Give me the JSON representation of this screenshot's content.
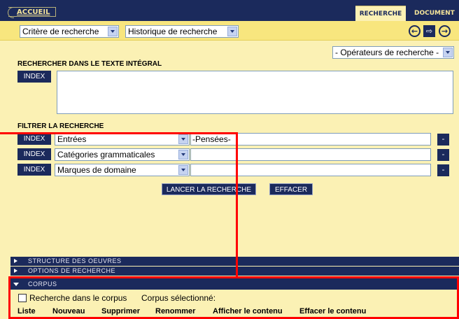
{
  "nav": {
    "home": "ACCUEIL",
    "tabs": [
      "RECHERCHE",
      "DOCUMENT"
    ]
  },
  "toolbar": {
    "criteria": "Critère de recherche",
    "history": "Historique de recherche",
    "icons": [
      "back-icon",
      "document-export-icon",
      "forward-icon"
    ]
  },
  "operators": "- Opérateurs de recherche -",
  "fulltext": {
    "heading": "RECHERCHER DANS LE TEXTE INTÉGRAL",
    "index_label": "INDEX",
    "value": ""
  },
  "filter": {
    "heading": "FILTRER LA RECHERCHE",
    "rows": [
      {
        "index": "INDEX",
        "field": "Entrées",
        "value": "-Pensées-",
        "remove": "-"
      },
      {
        "index": "INDEX",
        "field": "Catégories grammaticales",
        "value": "",
        "remove": "-"
      },
      {
        "index": "INDEX",
        "field": "Marques de domaine",
        "value": "",
        "remove": "-"
      }
    ]
  },
  "actions": {
    "search": "LANCER LA RECHERCHE",
    "clear": "EFFACER"
  },
  "sections": {
    "structure": "STRUCTURE DES OEUVRES",
    "options": "OPTIONS DE RECHERCHE",
    "corpus": "CORPUS"
  },
  "corpus": {
    "checkbox_label": "Recherche dans le corpus",
    "selected_label": "Corpus sélectionné:",
    "links": [
      "Liste",
      "Nouveau",
      "Supprimer",
      "Renommer",
      "Afficher le contenu",
      "Effacer le contenu"
    ]
  },
  "colors": {
    "navy": "#1b2a5c",
    "background": "#fbf1b4",
    "toolbar": "#f8e67e",
    "highlight": "#ff0000"
  }
}
